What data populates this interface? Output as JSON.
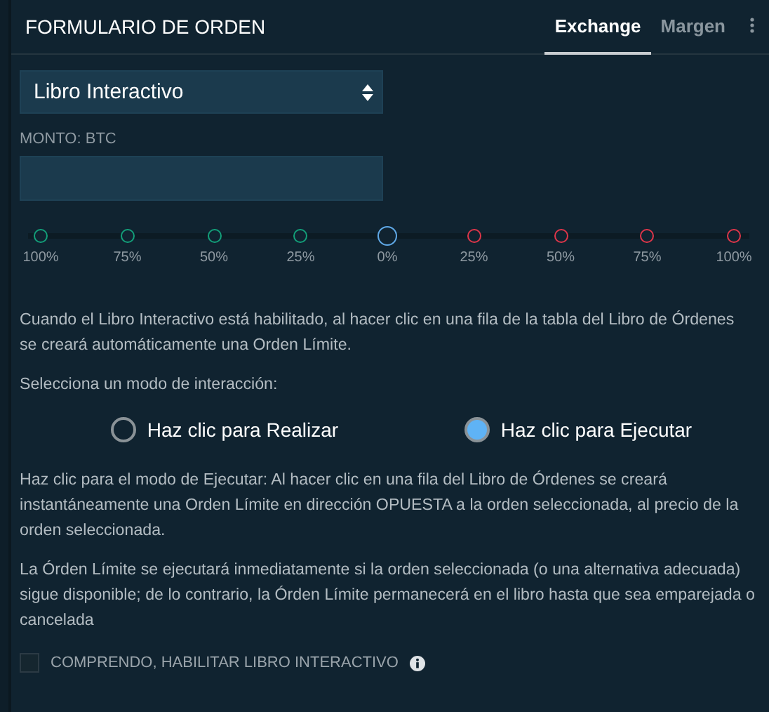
{
  "header": {
    "title": "FORMULARIO DE ORDEN",
    "tabs": [
      {
        "label": "Exchange",
        "selected": true
      },
      {
        "label": "Margen",
        "selected": false
      }
    ]
  },
  "order_type": {
    "value": "Libro Interactivo"
  },
  "amount": {
    "label": "MONTO: BTC"
  },
  "slider_marks": [
    {
      "label": "100%",
      "color": "#13a07a",
      "selected": false
    },
    {
      "label": "75%",
      "color": "#13a07a",
      "selected": false
    },
    {
      "label": "50%",
      "color": "#13a07a",
      "selected": false
    },
    {
      "label": "25%",
      "color": "#13a07a",
      "selected": false
    },
    {
      "label": "0%",
      "color": "#5fa8e6",
      "selected": true
    },
    {
      "label": "25%",
      "color": "#e0364a",
      "selected": false
    },
    {
      "label": "50%",
      "color": "#e0364a",
      "selected": false
    },
    {
      "label": "75%",
      "color": "#e0364a",
      "selected": false
    },
    {
      "label": "100%",
      "color": "#e0364a",
      "selected": false
    }
  ],
  "intro": "Cuando el Libro Interactivo está habilitado, al hacer clic en una fila de la tabla del Libro de Órdenes se creará automáticamente una Orden Límite.",
  "mode_prompt": "Selecciona un modo de interacción:",
  "modes": [
    {
      "label": "Haz clic para Realizar",
      "selected": false
    },
    {
      "label": "Haz clic para Ejecutar",
      "selected": true
    }
  ],
  "description": "Haz clic para el modo de Ejecutar: Al hacer clic en una fila del Libro de Órdenes se creará instantáneamente una Orden Límite en dirección OPUESTA a la orden seleccionada, al precio de la orden seleccionada.",
  "note": "La Órden Límite se ejecutará inmediatamente si la orden seleccionada (o una alternativa adecuada) sigue disponible; de lo contrario, la Órden Límite permanecerá en el libro hasta que sea emparejada o cancelada",
  "confirm": {
    "label": "COMPRENDO, HABILITAR LIBRO INTERACTIVO",
    "checked": false
  }
}
